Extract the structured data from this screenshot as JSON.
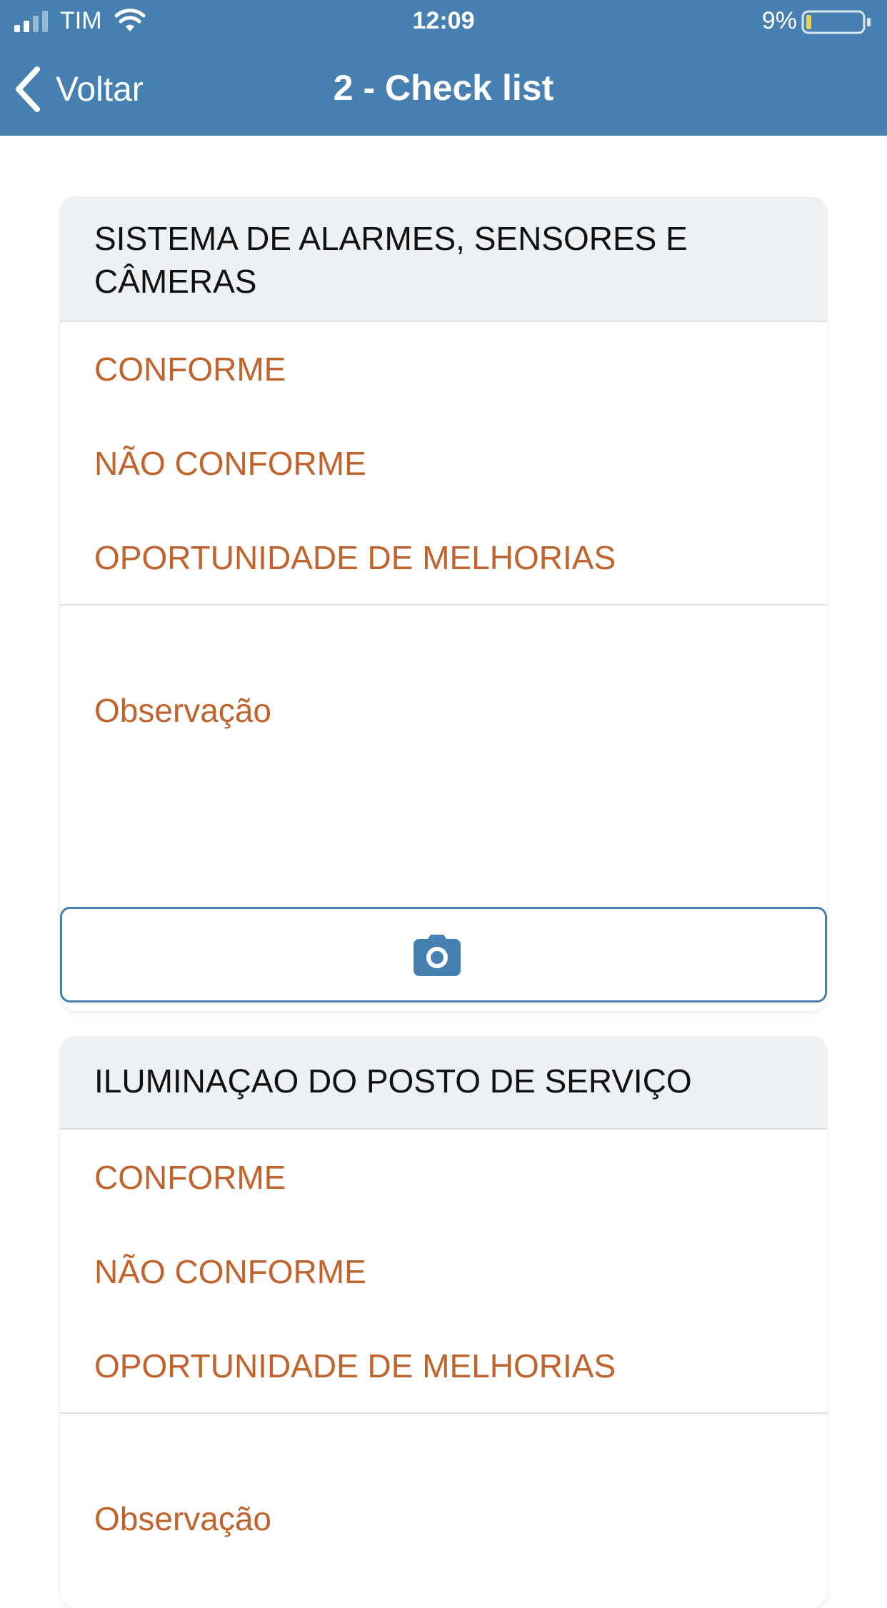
{
  "status_bar": {
    "carrier": "TIM",
    "time": "12:09",
    "battery_percent": "9%",
    "battery_level": 0.09
  },
  "nav": {
    "back_label": "Voltar",
    "title": "2 - Check list"
  },
  "colors": {
    "header": "#4680b0",
    "option_text": "#c0632c",
    "card_header_bg": "#eef1f4"
  },
  "sections": [
    {
      "title": "SISTEMA DE ALARMES, SENSORES E CÂMERAS",
      "options": [
        "CONFORME",
        "NÃO CONFORME",
        "OPORTUNIDADE DE MELHORIAS"
      ],
      "observation_placeholder": "Observação",
      "camera_icon": "camera-icon"
    },
    {
      "title": "ILUMINAÇAO DO POSTO DE SERVIÇO",
      "options": [
        "CONFORME",
        "NÃO CONFORME",
        "OPORTUNIDADE DE MELHORIAS"
      ],
      "observation_placeholder": "Observação"
    }
  ]
}
